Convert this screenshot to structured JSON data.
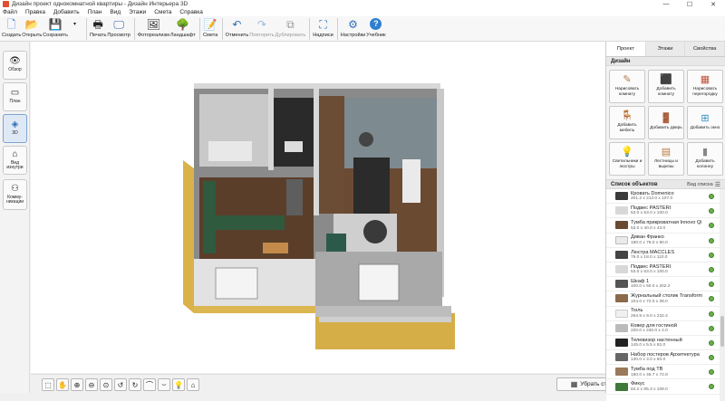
{
  "window": {
    "title": "Дизайн проект однокомнатной квартиры - Дизайн Интерьера 3D",
    "minimize": "—",
    "maximize": "☐",
    "close": "✕"
  },
  "menu": [
    "Файл",
    "Правка",
    "Добавить",
    "План",
    "Вид",
    "Этажи",
    "Смета",
    "Справка"
  ],
  "toolbar": {
    "create": "Создать",
    "open": "Открыть",
    "save": "Сохранить",
    "print": "Печать",
    "preview": "Просмотр",
    "photo": "Фотореализм",
    "landscape": "Ландшафт",
    "estimate": "Смета",
    "undo": "Отменить",
    "redo": "Повторить",
    "duplicate": "Дублировать",
    "labels": "Надписи",
    "settings": "Настройки",
    "tutorial": "Учебник"
  },
  "leftbar": {
    "overview": "Обзор",
    "plan": "План",
    "view3d": "3D",
    "walkthrough": "Вид изнутри",
    "communications": "Комму- никации"
  },
  "bottombar": {
    "walls_button": "Убрать стены"
  },
  "panel": {
    "tabs": [
      "Проект",
      "Этажи",
      "Свойства"
    ],
    "design_header": "Дизайн",
    "design_buttons": [
      {
        "label": "Нарисовать комнату",
        "icon": "✎"
      },
      {
        "label": "Добавить комнату",
        "icon": "⬛"
      },
      {
        "label": "Нарисовать перегородку",
        "icon": "▦"
      },
      {
        "label": "Добавить мебель",
        "icon": "🪑"
      },
      {
        "label": "Добавить дверь",
        "icon": "🚪"
      },
      {
        "label": "Добавить окно",
        "icon": "⊞"
      },
      {
        "label": "Светильники и люстры",
        "icon": "💡"
      },
      {
        "label": "Лестницы и вырезы",
        "icon": "▤"
      },
      {
        "label": "Добавить колонну",
        "icon": "▮"
      }
    ],
    "objects_header": "Список объектов",
    "view_list": "Вид списка",
    "objects": [
      {
        "name": "Кровать Domenico",
        "size": "201.2 x 213.0 x 107.0"
      },
      {
        "name": "Подвес PASTERI",
        "size": "53.0 x 53.0 x 100.0"
      },
      {
        "name": "Тумба прикроватная Innovo Qi",
        "size": "53.0 x 40.0 x 43.0"
      },
      {
        "name": "Диван Франко",
        "size": "180.0 x 78.0 x 80.0"
      },
      {
        "name": "Люстра MACCLES",
        "size": "79.0 x 18.0 x 110.0"
      },
      {
        "name": "Подвес PASTERI",
        "size": "53.0 x 53.0 x 100.0"
      },
      {
        "name": "Шкаф 1",
        "size": "100.0 x 50.0 x 202.2"
      },
      {
        "name": "Журнальный столик Transform",
        "size": "104.0 x 72.0 x 39.0"
      },
      {
        "name": "Тюль",
        "size": "264.9 x 9.0 x 232.4"
      },
      {
        "name": "Ковер для гостиной",
        "size": "220.0 x 240.0 x 2.0"
      },
      {
        "name": "Телевизор настенный",
        "size": "145.0 x 5.5 x 82.0"
      },
      {
        "name": "Набор постеров Архитектура",
        "size": "130.0 x 3.0 x 60.0"
      },
      {
        "name": "Тумба под ТВ",
        "size": "180.0 x 45.7 x 72.8"
      },
      {
        "name": "Фикус",
        "size": "84.2 x 85.3 x 108.0"
      }
    ]
  }
}
